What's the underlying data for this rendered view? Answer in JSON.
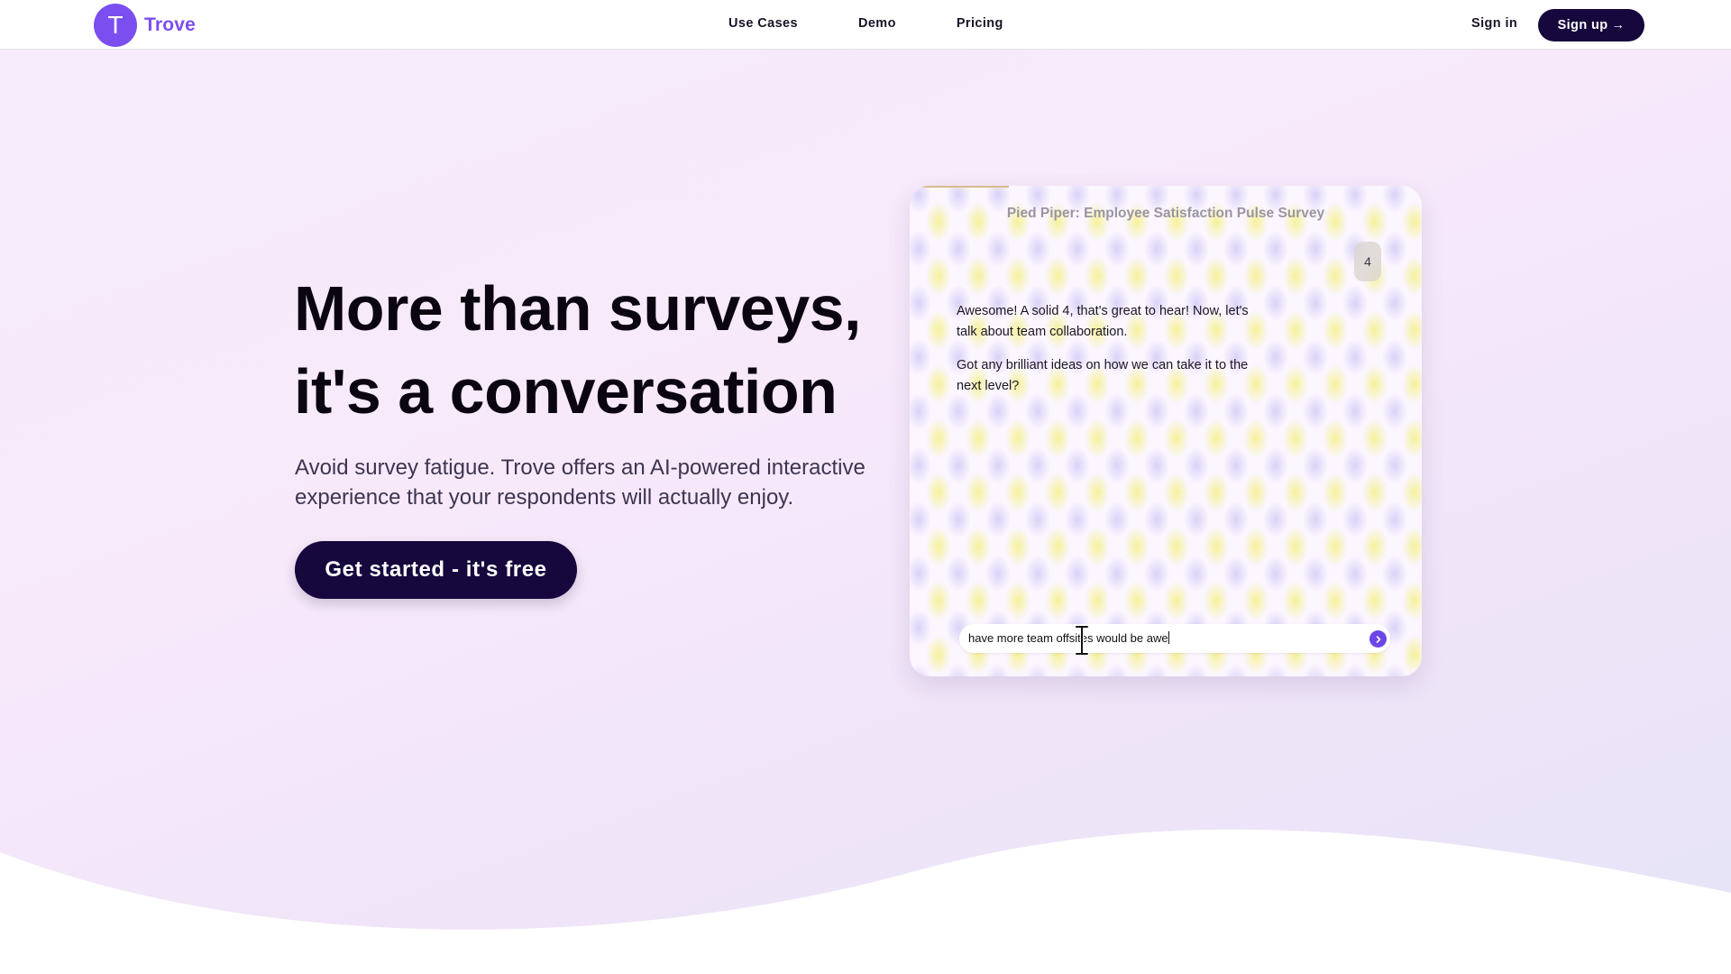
{
  "header": {
    "logo_letter": "T",
    "brand": "Trove",
    "nav": [
      {
        "label": "Use Cases"
      },
      {
        "label": "Demo"
      },
      {
        "label": "Pricing"
      }
    ],
    "signin_label": "Sign in",
    "signup_label": "Sign up",
    "signup_arrow": "→"
  },
  "hero": {
    "headline_line1": "More than surveys,",
    "headline_line2": "it's a conversation",
    "subtext": "Avoid survey fatigue. Trove offers an AI-powered interactive experience that your respondents will actually enjoy.",
    "cta_label": "Get started - it's free"
  },
  "survey": {
    "title": "Pied Piper: Employee Satisfaction Pulse Survey",
    "user_reply": "4",
    "bot_message_1": "Awesome! A solid 4, that's great to hear! Now, let's talk about team collaboration.",
    "bot_message_2": "Got any brilliant ideas on how we can take it to the next level?",
    "answer_value": "have more team offsites would be awe",
    "send_icon": "chevron-right-icon"
  },
  "colors": {
    "brand_purple": "#7b4ef0",
    "dark_navy": "#16073d"
  }
}
